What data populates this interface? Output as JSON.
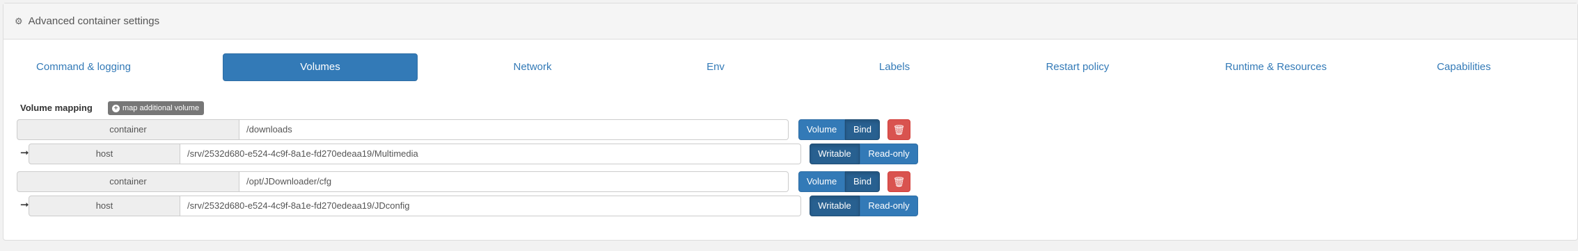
{
  "panel": {
    "title": "Advanced container settings",
    "icon": "gear-icon"
  },
  "tabs": [
    {
      "label": "Command & logging",
      "active": false
    },
    {
      "label": "Volumes",
      "active": true
    },
    {
      "label": "Network",
      "active": false
    },
    {
      "label": "Env",
      "active": false
    },
    {
      "label": "Labels",
      "active": false
    },
    {
      "label": "Restart policy",
      "active": false
    },
    {
      "label": "Runtime & Resources",
      "active": false
    },
    {
      "label": "Capabilities",
      "active": false
    }
  ],
  "volumes": {
    "label": "Volume mapping",
    "add_button": "map additional volume",
    "items": [
      {
        "container_label": "container",
        "container_path": "/downloads",
        "type_volume": "Volume",
        "type_bind": "Bind",
        "selected_type": "Bind",
        "host_label": "host",
        "host_path": "/srv/2532d680-e524-4c9f-8a1e-fd270edeaa19/Multimedia",
        "mode_writable": "Writable",
        "mode_readonly": "Read-only",
        "selected_mode": "Writable"
      },
      {
        "container_label": "container",
        "container_path": "/opt/JDownloader/cfg",
        "type_volume": "Volume",
        "type_bind": "Bind",
        "selected_type": "Bind",
        "host_label": "host",
        "host_path": "/srv/2532d680-e524-4c9f-8a1e-fd270edeaa19/JDconfig",
        "mode_writable": "Writable",
        "mode_readonly": "Read-only",
        "selected_mode": "Writable"
      }
    ]
  },
  "colors": {
    "primary": "#337ab7",
    "primary_active": "#286090",
    "danger": "#d9534f",
    "addon_bg": "#eeeeee"
  }
}
